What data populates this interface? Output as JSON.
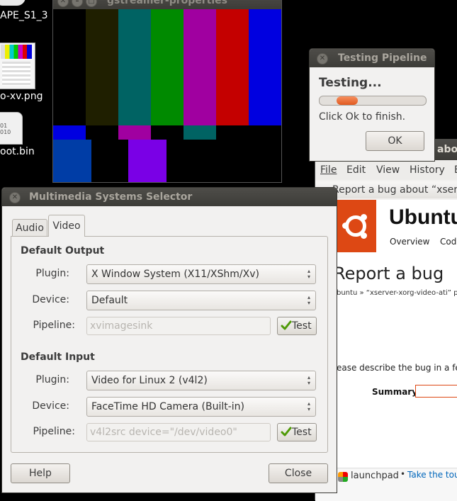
{
  "desktop": {
    "icon1_label": "APE_S1_3",
    "icon2_label": "o-xv.png",
    "icon3_label": "oot.bin",
    "icon3_glyph": "01\n010"
  },
  "gst_window": {
    "title": "gstreamer-properties"
  },
  "testing_dialog": {
    "title": "Testing Pipeline",
    "heading": "Testing...",
    "message": "Click Ok to finish.",
    "ok_label": "OK",
    "progress": 0.2
  },
  "browser": {
    "title_fragment": "abou",
    "menu": [
      "File",
      "Edit",
      "View",
      "History",
      "B"
    ],
    "tab_title": "Report a bug about “xserve",
    "ubuntu_word": "Ubuntu",
    "nav_overview": "Overview",
    "nav_code": "Code",
    "heading": "Report a bug",
    "breadcrumb": "buntu » “xserver-xorg-video-ati” packa",
    "describe": "ease describe the bug in a few",
    "summary_label": "Summary:",
    "launchpad": "launchpad",
    "bullet": "•",
    "tour": "Take the tour"
  },
  "mss": {
    "title": "Multimedia Systems Selector",
    "tabs": [
      "Audio",
      "Video"
    ],
    "output": {
      "heading": "Default Output",
      "plugin_label": "Plugin:",
      "plugin_value": "X Window System (X11/XShm/Xv)",
      "device_label": "Device:",
      "device_value": "Default",
      "pipeline_label": "Pipeline:",
      "pipeline_value": "xvimagesink",
      "test_label": "Test"
    },
    "input": {
      "heading": "Default Input",
      "plugin_label": "Plugin:",
      "plugin_value": "Video for Linux 2 (v4l2)",
      "device_label": "Device:",
      "device_value": "FaceTime HD Camera (Built-in)",
      "pipeline_label": "Pipeline:",
      "pipeline_value": "v4l2src device=\"/dev/video0\"",
      "test_label": "Test"
    },
    "help_label": "Help",
    "close_label": "Close"
  },
  "colors": {
    "ubuntu_orange": "#dd4814",
    "progress_orange": "#f07746",
    "link_blue": "#0066bb"
  }
}
